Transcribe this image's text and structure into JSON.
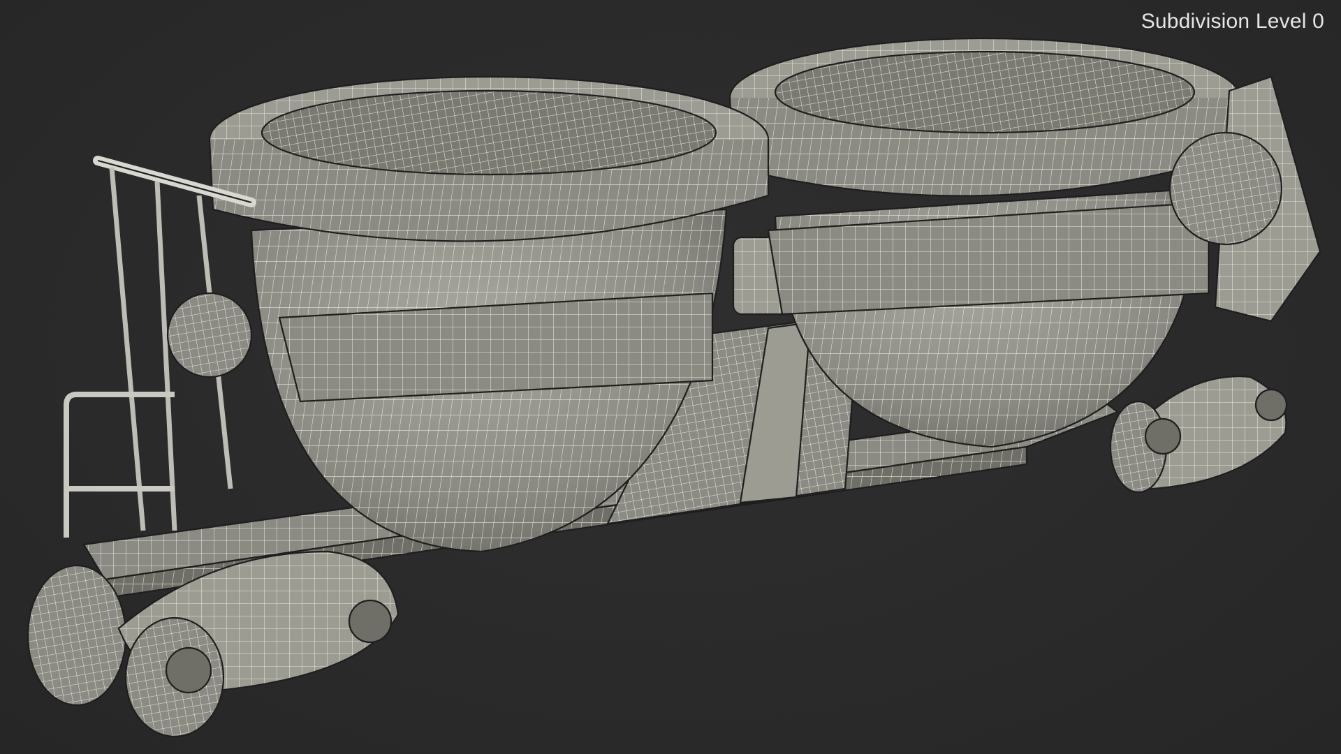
{
  "viewport": {
    "overlay_label": "Subdivision Level 0",
    "background_color": "#2b2b2b",
    "model_base_color": "#8f8f87",
    "wire_color": "#f2f2ea"
  },
  "model": {
    "parts": [
      "left-ladle",
      "right-ladle",
      "rail-car-frame",
      "front-bogie",
      "rear-bogie",
      "handrail",
      "tilt-mechanism",
      "center-support"
    ]
  }
}
